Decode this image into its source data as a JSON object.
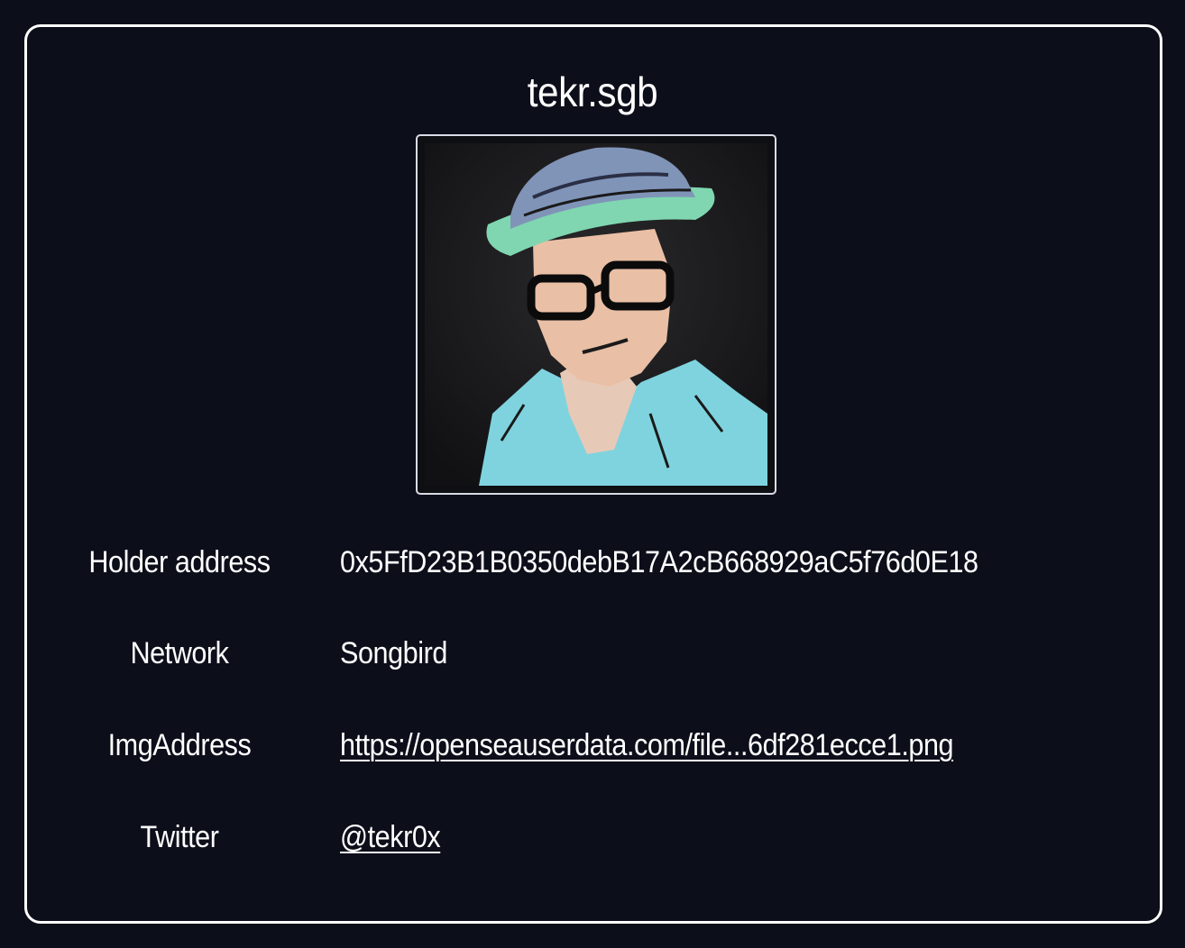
{
  "card": {
    "title": "tekr.sgb",
    "avatar_icon": "profile-avatar-illustration"
  },
  "details": [
    {
      "label": "Holder address",
      "value": "0x5FfD23B1B0350debB17A2cB668929aC5f76d0E18"
    },
    {
      "label": "Network",
      "value": "Songbird"
    },
    {
      "label": "ImgAddress",
      "value": "https://openseauserdata.com/file...6df281ecce1.png"
    },
    {
      "label": "Twitter",
      "value": "@tekr0x"
    }
  ],
  "colors": {
    "background": "#0c0e1a",
    "border": "#ffffff",
    "text": "#ffffff"
  }
}
